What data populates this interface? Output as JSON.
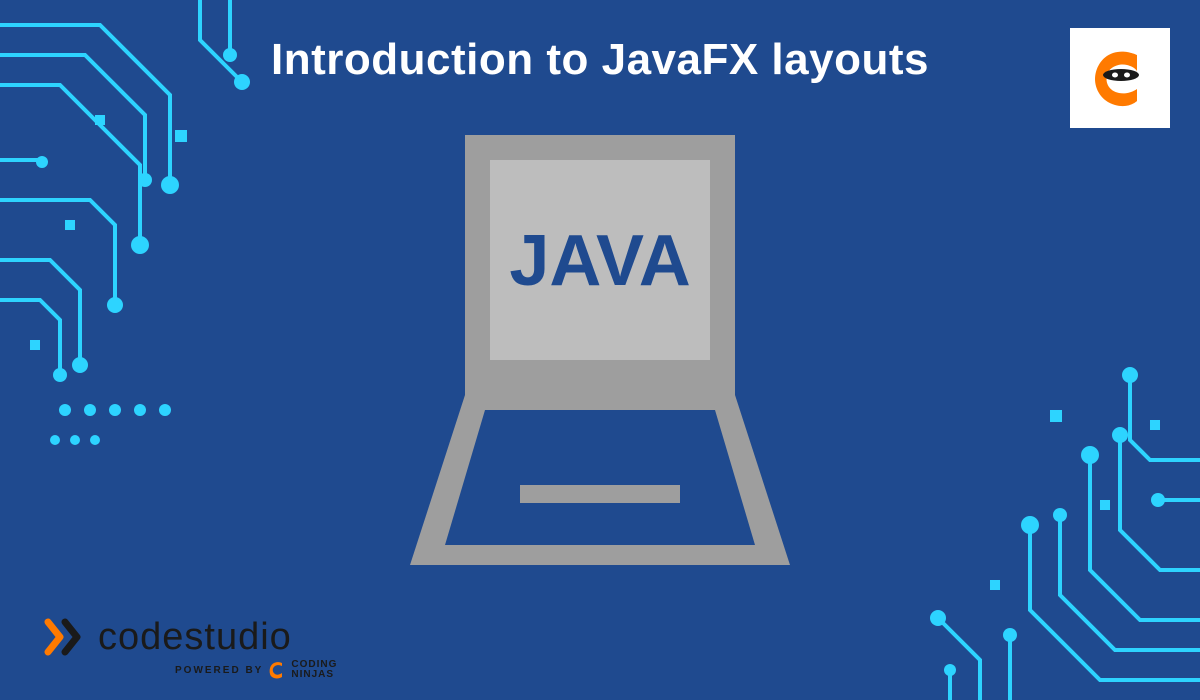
{
  "title": "Introduction to JavaFX layouts",
  "laptop": {
    "screen_text": "JAVA"
  },
  "logo": {
    "name": "coding-ninjas-logo"
  },
  "footer": {
    "brand_code": "code",
    "brand_studio": "studio",
    "powered_by": "POWERED BY",
    "coding": "CODING",
    "ninjas": "NINJAS"
  },
  "colors": {
    "background": "#1f4a8f",
    "circuit": "#00d4ff",
    "laptop_body": "#9e9e9e",
    "laptop_text": "#1f4a8f",
    "brand_orange": "#ff7a00",
    "brand_dark": "#1a1a1a"
  }
}
